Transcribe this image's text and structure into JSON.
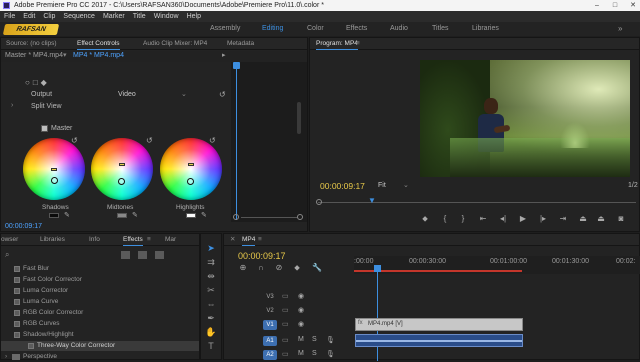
{
  "window": {
    "title": "Adobe Premiere Pro CC 2017 - C:\\Users\\RAFSAN360\\Documents\\Adobe\\Premiere Pro\\11.0\\.color *"
  },
  "menu": [
    "File",
    "Edit",
    "Clip",
    "Sequence",
    "Marker",
    "Title",
    "Window",
    "Help"
  ],
  "workspaces": [
    "Assembly",
    "Editing",
    "Color",
    "Effects",
    "Audio",
    "Titles",
    "Libraries"
  ],
  "active_workspace": "Editing",
  "logo_text": "RAFSAN",
  "effect_controls": {
    "tabs": [
      "Source: (no clips)",
      "Effect Controls",
      "Audio Clip Mixer: MP4",
      "Metadata"
    ],
    "active_tab": "Effect Controls",
    "master_clip": "Master * MP4.mp4",
    "sequence_clip": "MP4 * MP4.mp4",
    "output_label": "Output",
    "output_value": "Video",
    "split_view_label": "Split View",
    "master_label": "Master",
    "wheels": [
      "Shadows",
      "Midtones",
      "Highlights"
    ],
    "timecode": "00:00:09:17"
  },
  "program": {
    "title": "Program: MP4",
    "timecode": "00:00:09:17",
    "fit_label": "Fit",
    "page_indicator": "1/2"
  },
  "effects_panel": {
    "tabs": [
      "owser",
      "Libraries",
      "Info",
      "Effects",
      "Mar"
    ],
    "active_tab": "Effects",
    "items": [
      "Fast Blur",
      "Fast Color Corrector",
      "Luma Corrector",
      "Luma Curve",
      "RGB Color Corrector",
      "RGB Curves",
      "Shadow/Highlight",
      "Three-Way Color Corrector"
    ],
    "folder": "Perspective"
  },
  "timeline": {
    "tab": "MP4",
    "timecode": "00:00:09:17",
    "ruler": [
      ":00:00",
      "00:00:30:00",
      "00:01:00:00",
      "00:01:30:00",
      "00:02:"
    ],
    "tracks": [
      "V3",
      "V2",
      "V1",
      "A1",
      "A2"
    ],
    "clip_label": "MP4.mp4 [V]"
  },
  "colors": {
    "accent": "#3d8fe0",
    "timecode": "#e8c94a",
    "panel_bg": "#232323"
  }
}
